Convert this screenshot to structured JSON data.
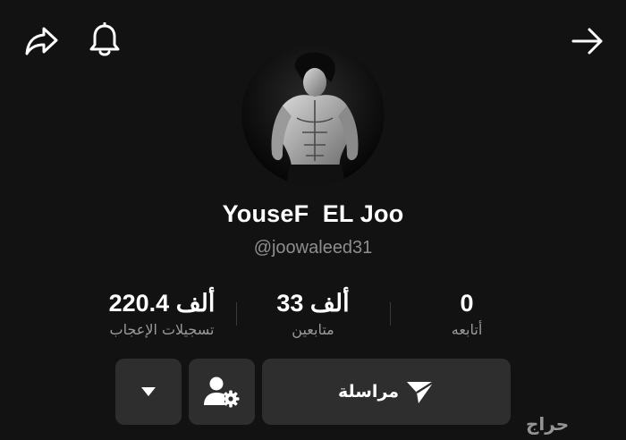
{
  "header": {
    "share_icon": "share-arrow-icon",
    "notification_icon": "bell-icon",
    "back_icon": "arrow-right-icon"
  },
  "profile": {
    "display_name": "YouseF  EL Joo",
    "username": "@joowaleed31"
  },
  "stats": [
    {
      "value": "220.4 ألف",
      "label": "تسجيلات الإعجاب"
    },
    {
      "value": "33 ألف",
      "label": "متابعين"
    },
    {
      "value": "0",
      "label": "أتابعه"
    }
  ],
  "actions": {
    "message_label": "مراسلة",
    "message_icon": "send-icon",
    "user_settings_icon": "user-gear-icon",
    "dropdown_icon": "caret-down-icon"
  },
  "watermark": "حراج",
  "colors": {
    "background": "#121212",
    "button": "#2e2e2e",
    "secondary_text": "#8e8e8e"
  }
}
